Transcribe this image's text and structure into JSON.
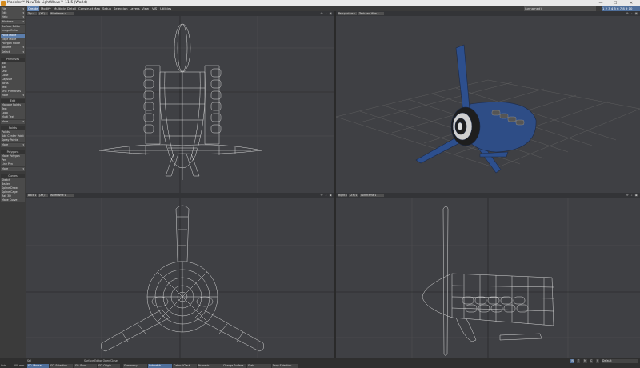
{
  "titlebar": {
    "title": "Modeler™ NewTek LightWave™ 11.5 (World)",
    "minimize": "—",
    "maximize": "☐",
    "close": "✕"
  },
  "menubar": {
    "items": [
      "Create",
      "Modify",
      "Multiply",
      "Detail",
      "Construct",
      "Map",
      "Setup",
      "Selection",
      "Layers",
      "View",
      "VIS",
      "Utilities"
    ],
    "active": "Create",
    "layer_select": "(unnamed)",
    "layer_toggle_label": "1 2 3 4 5 6 7 8 9 10"
  },
  "sidebar": {
    "top_drops": [
      "File",
      "Edit",
      "Help"
    ],
    "windows": "Windows",
    "windows_items": [
      "Surface Editor",
      "Image Editor"
    ],
    "modes": [
      "Point Mode",
      "Edge Mode",
      "Polygon Mode"
    ],
    "volume": "Volume",
    "select": "Select",
    "primitives_head": "Primitives",
    "primitives": [
      "Box",
      "Ball",
      "Disc",
      "Cone",
      "Capsule",
      "Torus",
      "Text",
      "Unit Primitives"
    ],
    "more1": "More",
    "edit_head": "Edit",
    "edit_items": [
      "Manage Points",
      "Text",
      "Logo",
      "Multi Text"
    ],
    "more2": "More",
    "points_head": "Points",
    "points": [
      "Points",
      "Add Center Point",
      "Spray Points"
    ],
    "more3": "More",
    "polygons_head": "Polygons",
    "polygons": [
      "Make Polygon",
      "Pen",
      "Line Pen"
    ],
    "more4": "More",
    "curves_head": "Curves",
    "curves": [
      "Sketch",
      "Bezier",
      "Spline Draw",
      "Spline Cage",
      "Rail 3D",
      "Make Curve"
    ]
  },
  "viewports": [
    {
      "name": "Top",
      "mode": "Wireframe",
      "numcode": "(XZ)"
    },
    {
      "name": "Perspective",
      "mode": "Textured Wire",
      "numcode": ""
    },
    {
      "name": "Back",
      "mode": "Wireframe",
      "numcode": "(XY)"
    },
    {
      "name": "Right",
      "mode": "Wireframe",
      "numcode": "(ZY)"
    }
  ],
  "viewport_icons": "✣ ⌕ ▣",
  "status": {
    "row1_left": "Sel",
    "row1_msg": "Surface Editor Open/Close",
    "grid_label": "Grid",
    "grid_value": "200 mm",
    "buttons": [
      "SC: Mouse",
      "SC: Selection",
      "SC: Pivot",
      "SC: Origin",
      "Symmetry",
      "Subpatch",
      "CatmullClark",
      "Numeric",
      "Change Surface",
      "Stats",
      "Drop Selection"
    ],
    "right_label": "Default",
    "bkg_tabs": [
      "W",
      "T",
      "M",
      "C",
      "S"
    ]
  }
}
